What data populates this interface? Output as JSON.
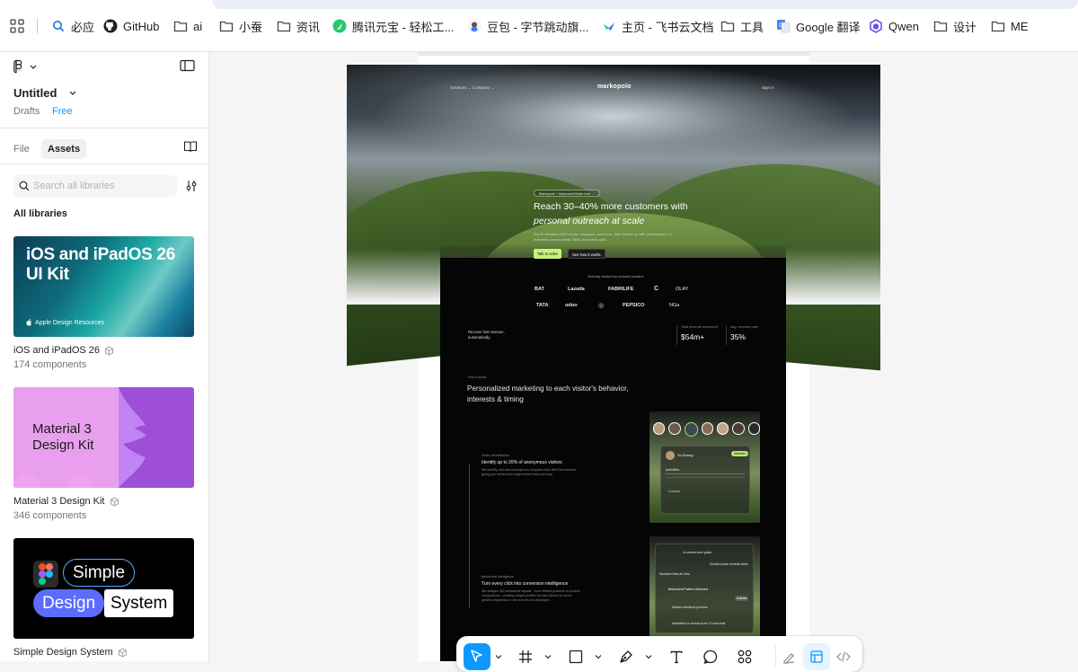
{
  "bookmarks": [
    {
      "label": "必应",
      "icon": "search-icon"
    },
    {
      "label": "GitHub",
      "icon": "github-icon"
    },
    {
      "label": "ai",
      "icon": "folder-icon"
    },
    {
      "label": "小蚕",
      "icon": "folder-icon"
    },
    {
      "label": "资讯",
      "icon": "folder-icon"
    },
    {
      "label": "腾讯元宝 - 轻松工...",
      "icon": "yuanbao-icon"
    },
    {
      "label": "豆包 - 字节跳动旗...",
      "icon": "doubao-icon"
    },
    {
      "label": "主页 - 飞书云文档",
      "icon": "feishu-icon"
    },
    {
      "label": "工具",
      "icon": "folder-icon"
    },
    {
      "label": "Google 翻译",
      "icon": "google-translate-icon"
    },
    {
      "label": "Qwen",
      "icon": "qwen-icon"
    },
    {
      "label": "设计",
      "icon": "folder-icon"
    },
    {
      "label": "ME",
      "icon": "folder-icon"
    }
  ],
  "panel": {
    "file_name": "Untitled",
    "location": "Drafts",
    "plan": "Free",
    "tabs": [
      "File",
      "Assets"
    ],
    "active_tab": "Assets",
    "search_placeholder": "Search all libraries",
    "section_title": "All libraries",
    "libraries": [
      {
        "name": "iOS and iPadOS 26",
        "count": "174 components",
        "thumb_title": "iOS and iPadOS 26 UI Kit",
        "thumb_badge": "Apple Design Resources"
      },
      {
        "name": "Material 3 Design Kit",
        "count": "346 components",
        "thumb_title": "Material 3 Design Kit"
      },
      {
        "name": "Simple Design System",
        "count": "",
        "thumb_words": [
          "Simple",
          "Design",
          "System"
        ]
      }
    ]
  },
  "frame": {
    "nav": {
      "left": [
        "Solutions ⌄",
        "Company ⌄"
      ],
      "logo": "markopolo",
      "right": "Sign in"
    },
    "badge": "Markopolo + AdvancedVisitor Intel →",
    "headline_1": "Reach 30–40% more customers with",
    "headline_2": "personal outreach at scale",
    "subtext": "Our AI identifies 40% of your shoppers, and more, then follows up with personalized 1:1 marketing across email, SMS, and voice calls.",
    "cta_primary": "Talk to sales",
    "cta_secondary": "See how it works",
    "trusted": "Globally trusted by industry leaders",
    "brands_row1": [
      "BAT",
      "Lazada",
      "FABRILIFE",
      "C",
      "OLAY"
    ],
    "brands_row2": [
      "TATA",
      "odoo",
      "◎",
      "PEPSICO",
      "NGa"
    ],
    "recover": "Recover lost revenue, automatically.",
    "stats": [
      {
        "label": "Total revenue recovered",
        "value": "$54m+"
      },
      {
        "label": "Avg. recovery rate",
        "value": "35%"
      }
    ],
    "section_kicker": "How it works",
    "section_title": "Personalized marketing to each visitor's behavior, interests & timing",
    "features": [
      {
        "kicker": "Visitor Identification",
        "title": "Identify up to 20% of anonymous visitors",
        "desc": "We identify and track anonymous shoppers from their first session, giving you behavioral insight before they ever buy."
      },
      {
        "kicker": "Behavioral Intelligence",
        "title": "Turn every click into conversion intelligence",
        "desc": "We analyze 300 behavioral signals - from viewed products to product comparisons - creating unique profiles for each visitor for micro-generic segments or one-size-fits-all campaigns."
      }
    ],
    "shot1": {
      "name": "Vo Duong",
      "tag": "Matched",
      "section": "Activities",
      "contact": "Contact"
    },
    "shot2": {
      "lines": [
        "Jo viewed size guide",
        "Scrolled price reviews twice",
        "Matched Nike Air Max",
        "Behavioral Pattern Detected",
        "Started checkout process",
        "Hesitated on checkout for 2.5 seconds"
      ],
      "chip": "Activate"
    }
  },
  "toolbar": {
    "tools": [
      "move-tool",
      "frame-tool",
      "shape-tool",
      "pen-tool",
      "text-tool",
      "comment-tool",
      "actions-tool",
      "draw-mode",
      "design-mode",
      "dev-mode"
    ],
    "active": "move-tool",
    "accent": "#0d99ff"
  },
  "colors": {
    "accent": "#0d99ff",
    "cta_green": "#c9f27a"
  }
}
